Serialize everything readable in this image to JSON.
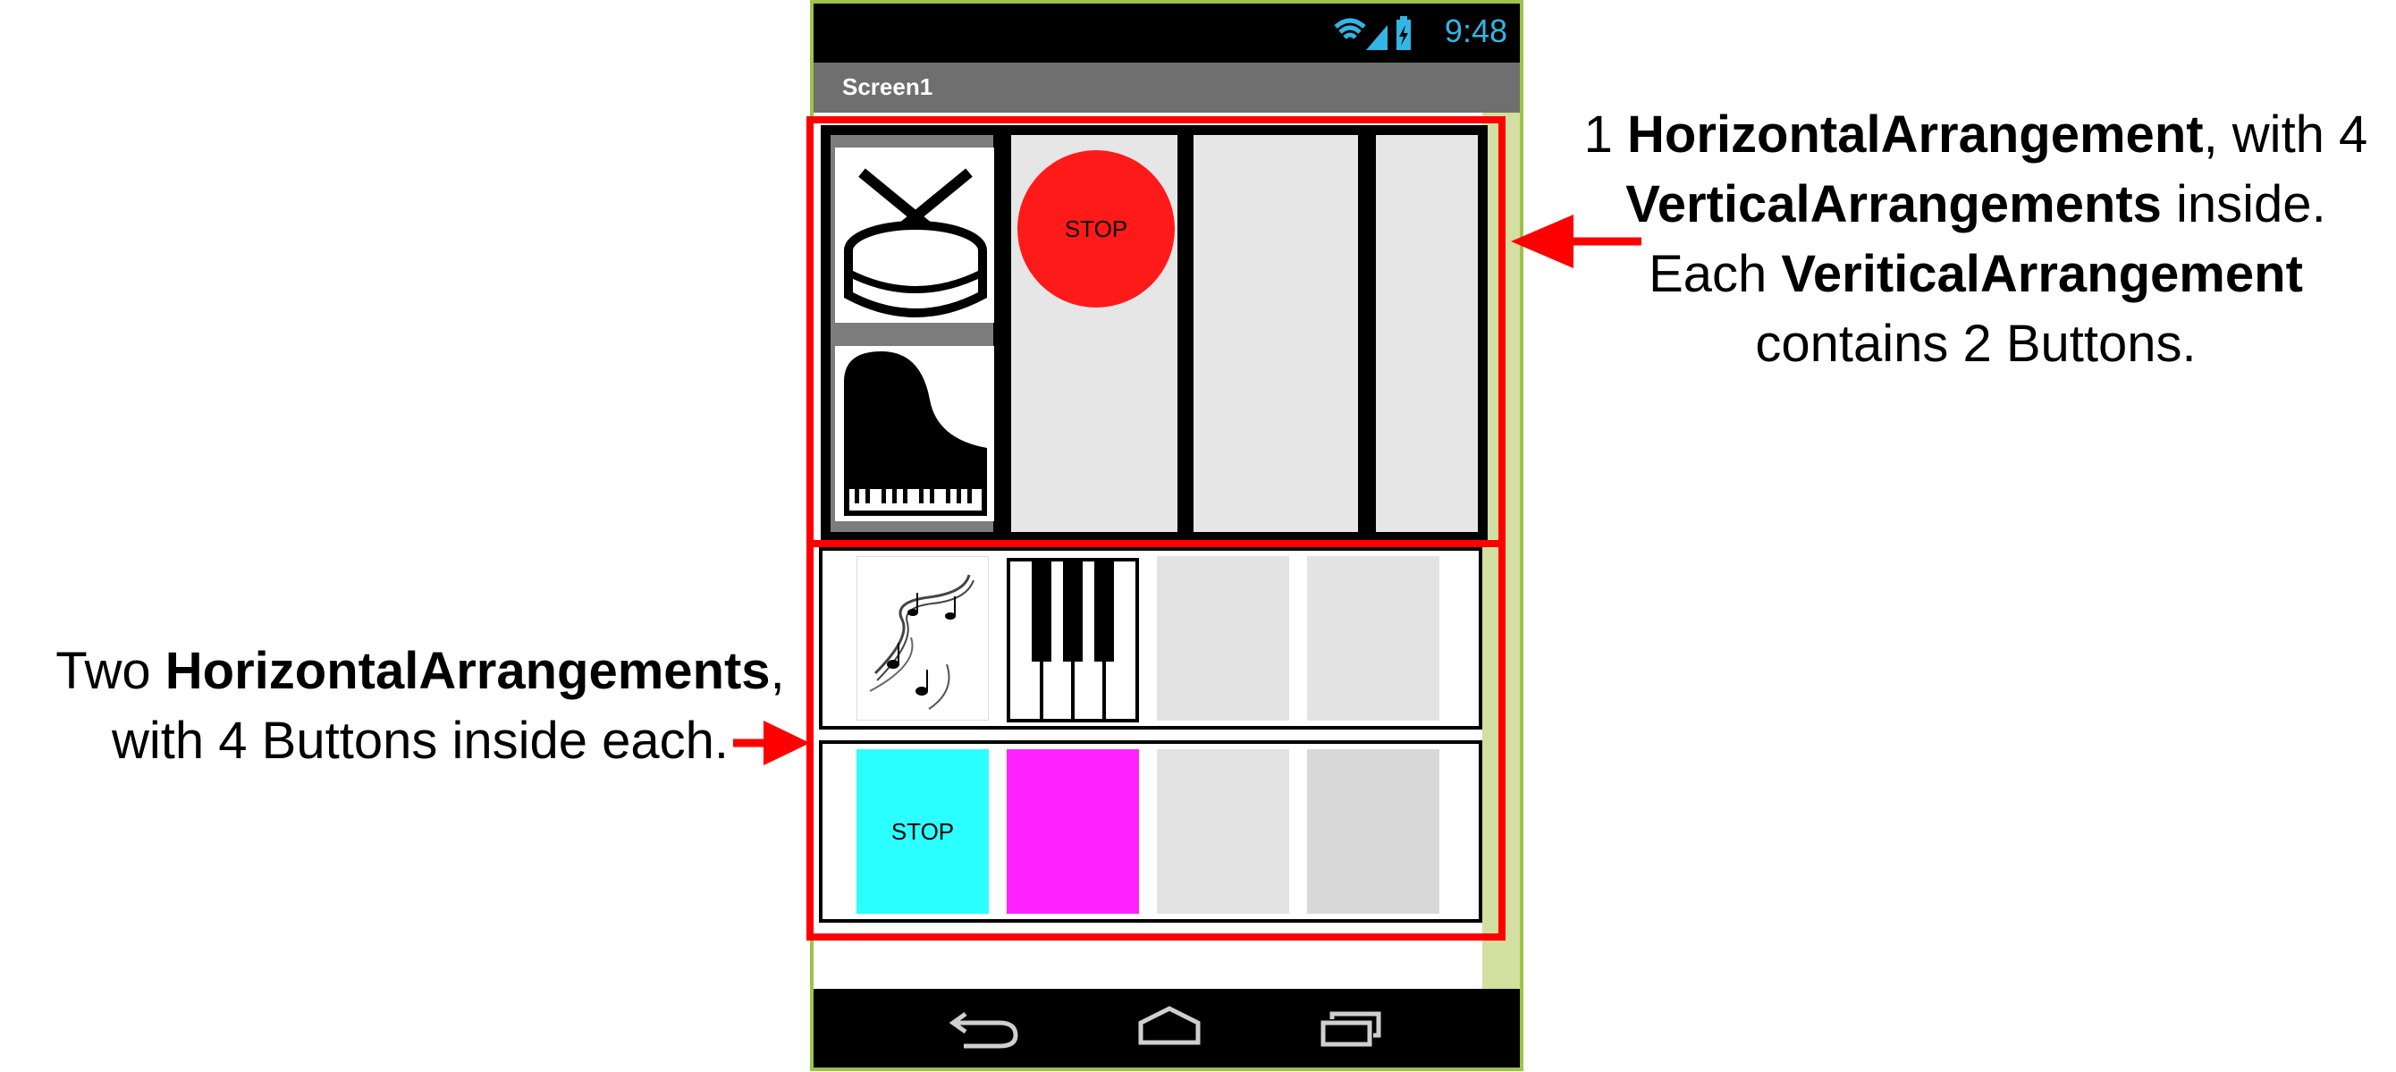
{
  "phone": {
    "clock": "9:48",
    "screen_title": "Screen1",
    "icons": [
      "wifi-icon",
      "signal-icon",
      "battery-icon"
    ],
    "nav_icons": [
      "back-icon",
      "home-icon",
      "recent-apps-icon"
    ]
  },
  "arrangements": {
    "top": {
      "stop_button_label": "STOP",
      "stop_button_color": "#ff1a1a"
    },
    "row2": {
      "buttons": [
        "music-notes-image",
        "piano-keys-image",
        "",
        ""
      ]
    },
    "row3": {
      "stop_button_label": "STOP",
      "cyan_color": "#2cffff",
      "magenta_color": "#ff22ff"
    }
  },
  "annotations": {
    "right": {
      "line1_prefix": "1 ",
      "line1_bold": "HorizontalArrangement",
      "line1_suffix": ", with 4",
      "line2_bold": "VerticalArrangements",
      "line2_suffix": " inside.",
      "line3_prefix": "Each ",
      "line3_bold": "VeriticalArrangement",
      "line4": "contains 2 Buttons."
    },
    "left": {
      "line1_prefix": "Two ",
      "line1_bold": "HorizontalArrangements",
      "line1_suffix": ",",
      "line2": "with 4 Buttons inside each."
    }
  },
  "colors": {
    "annotation_red": "#ff0000",
    "phone_border": "#9dc34a",
    "clock": "#33b5e5"
  }
}
